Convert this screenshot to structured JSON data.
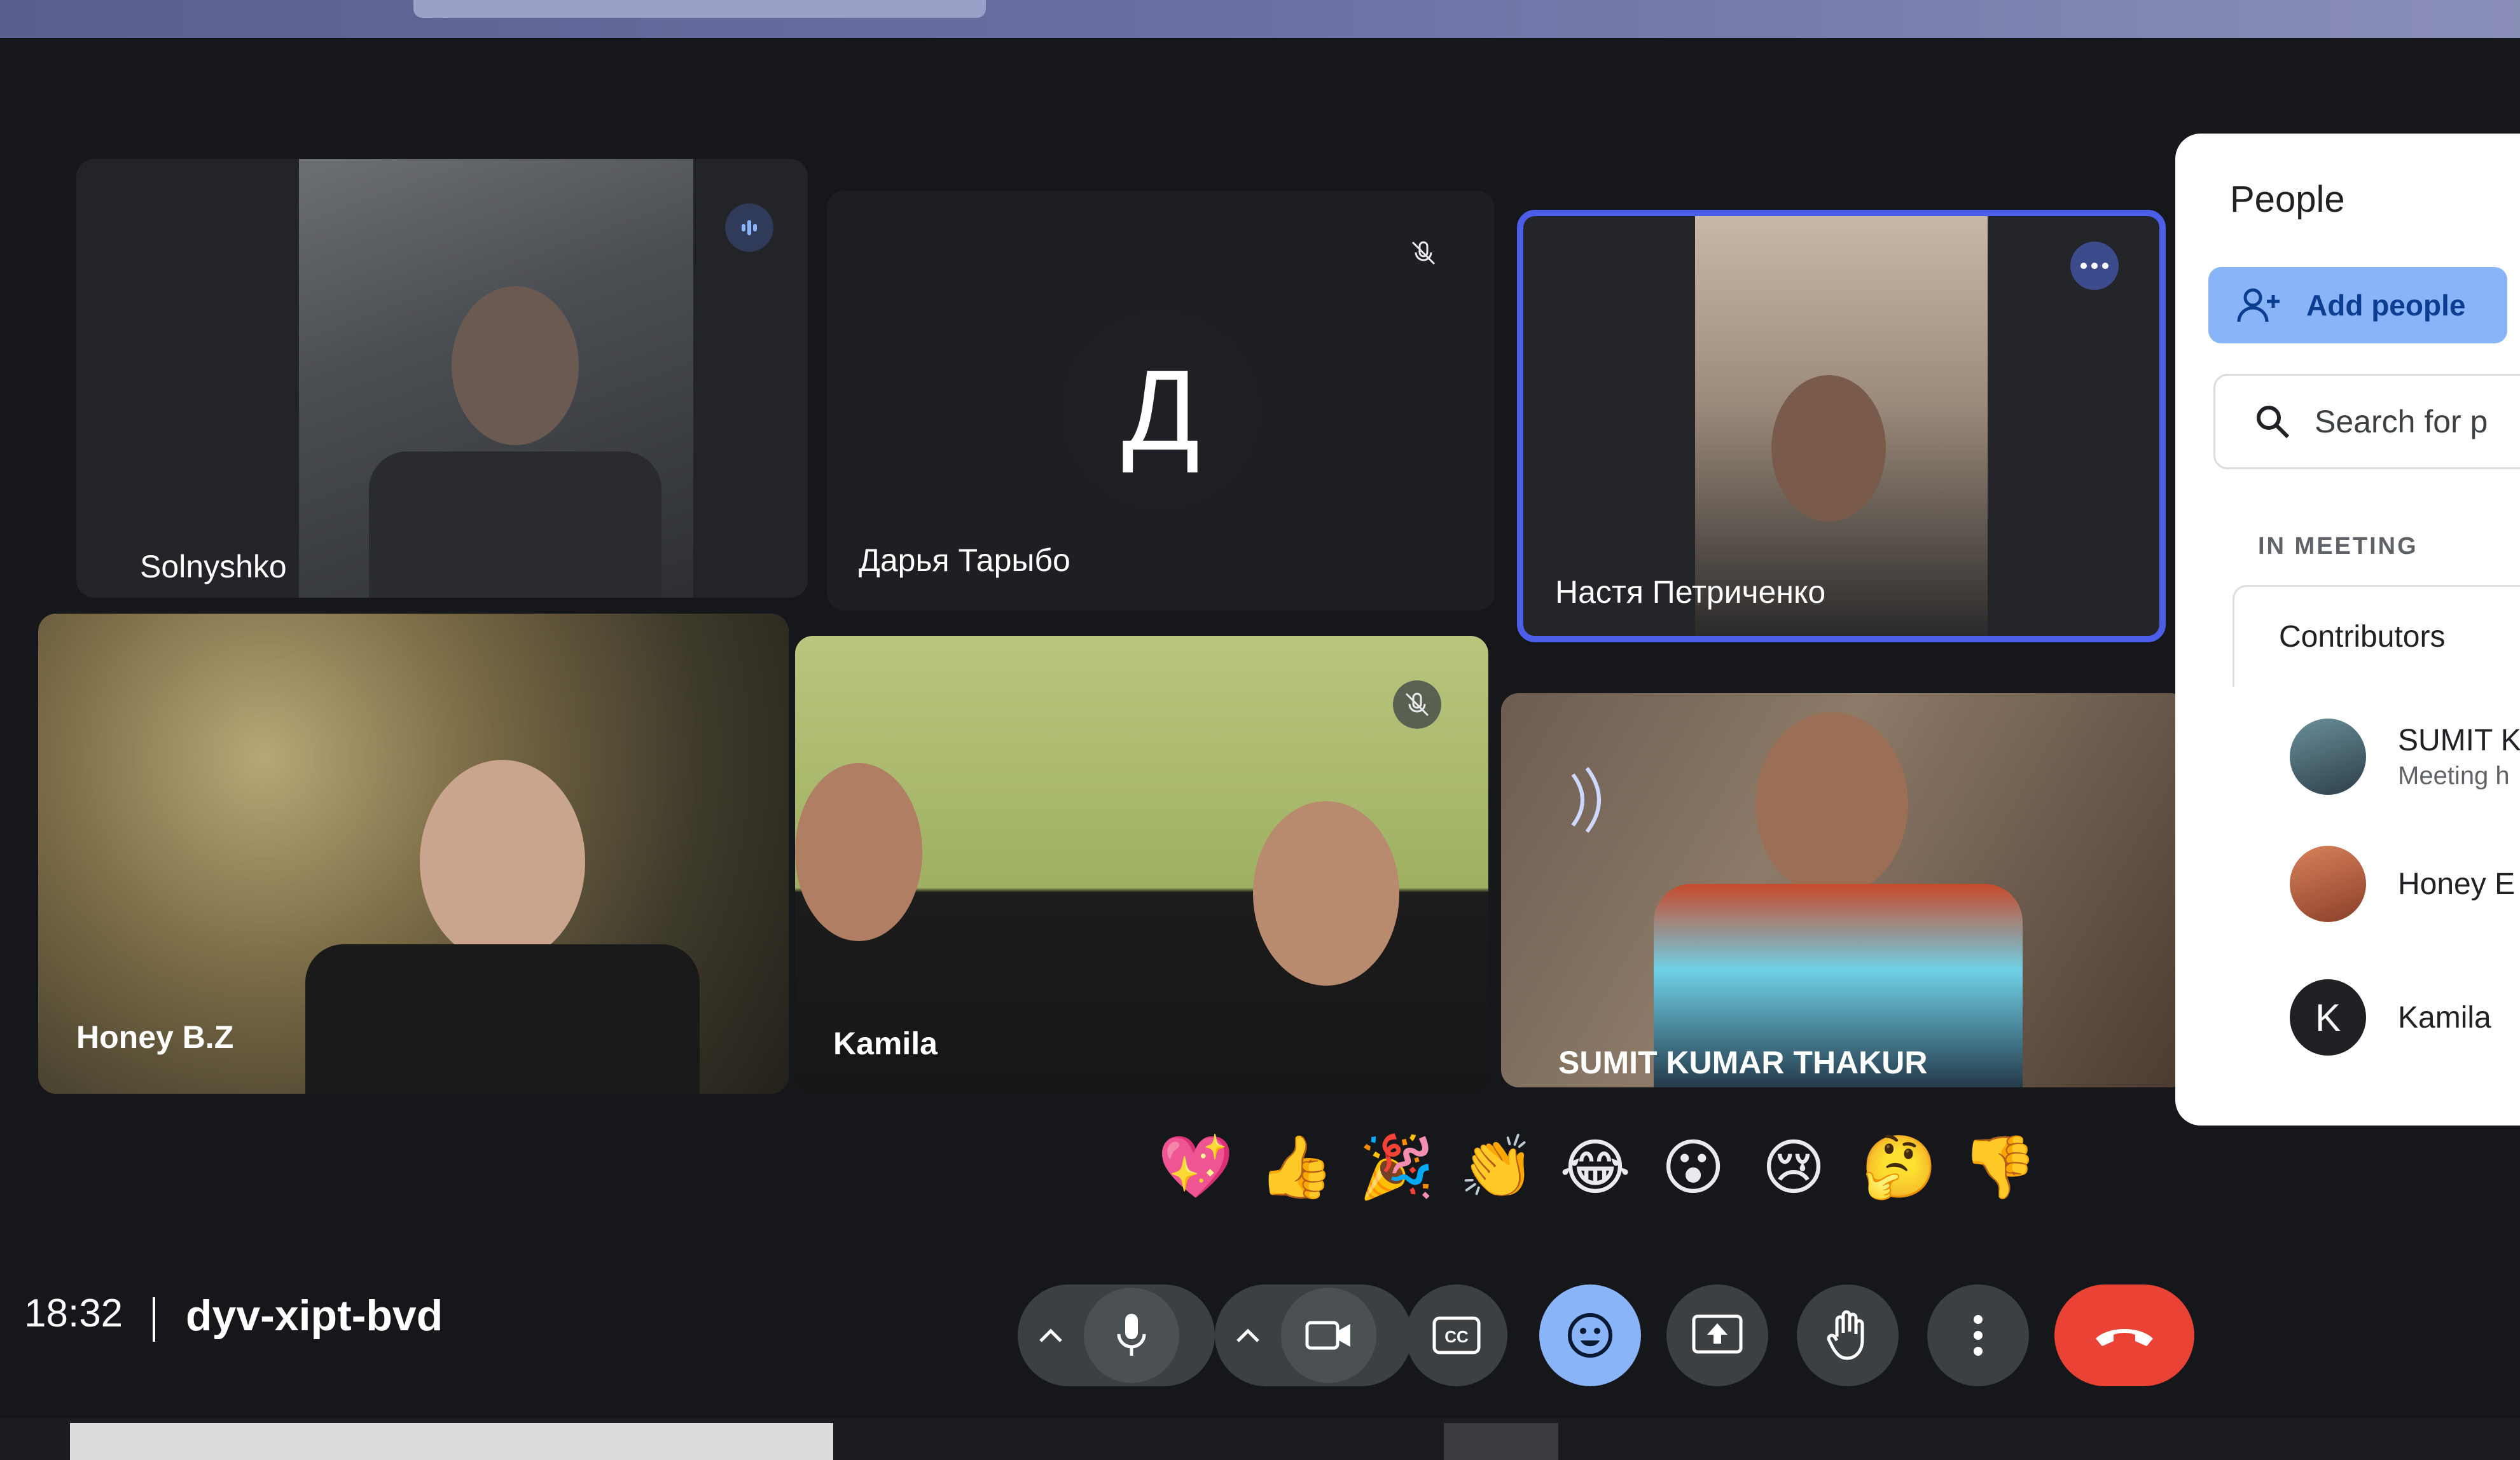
{
  "meeting": {
    "time": "18:32",
    "code": "dyv-xipt-bvd"
  },
  "participants": [
    {
      "name": "Solnyshko"
    },
    {
      "name": "Дарья Тарыбо",
      "avatar_letter": "Д",
      "muted": true
    },
    {
      "name": "Настя Петриченко",
      "highlighted": true
    },
    {
      "name": "Honey B.Z"
    },
    {
      "name": "Kamila",
      "muted": true
    },
    {
      "name": "SUMIT KUMAR THAKUR",
      "speaking": true
    }
  ],
  "people_panel": {
    "title": "People",
    "add_people_label": "Add people",
    "search_placeholder": "Search for p",
    "section_label": "IN MEETING",
    "contributors_label": "Contributors",
    "members": [
      {
        "name": "SUMIT KU",
        "subtitle": "Meeting h"
      },
      {
        "name": "Honey E"
      },
      {
        "name": "Kamila",
        "avatar_letter": "K"
      }
    ]
  },
  "reactions": [
    "💖",
    "👍",
    "🎉",
    "👏",
    "😂",
    "😮",
    "😢",
    "🤔",
    "👎"
  ],
  "colors": {
    "accent": "#8ab4f8",
    "end_call": "#ea4335",
    "tile_highlight": "#4c5de8"
  },
  "controls": [
    "mic-icon",
    "camera-icon",
    "captions-icon",
    "emoji-icon",
    "present-icon",
    "raise-hand-icon",
    "more-icon",
    "end-call-icon"
  ]
}
